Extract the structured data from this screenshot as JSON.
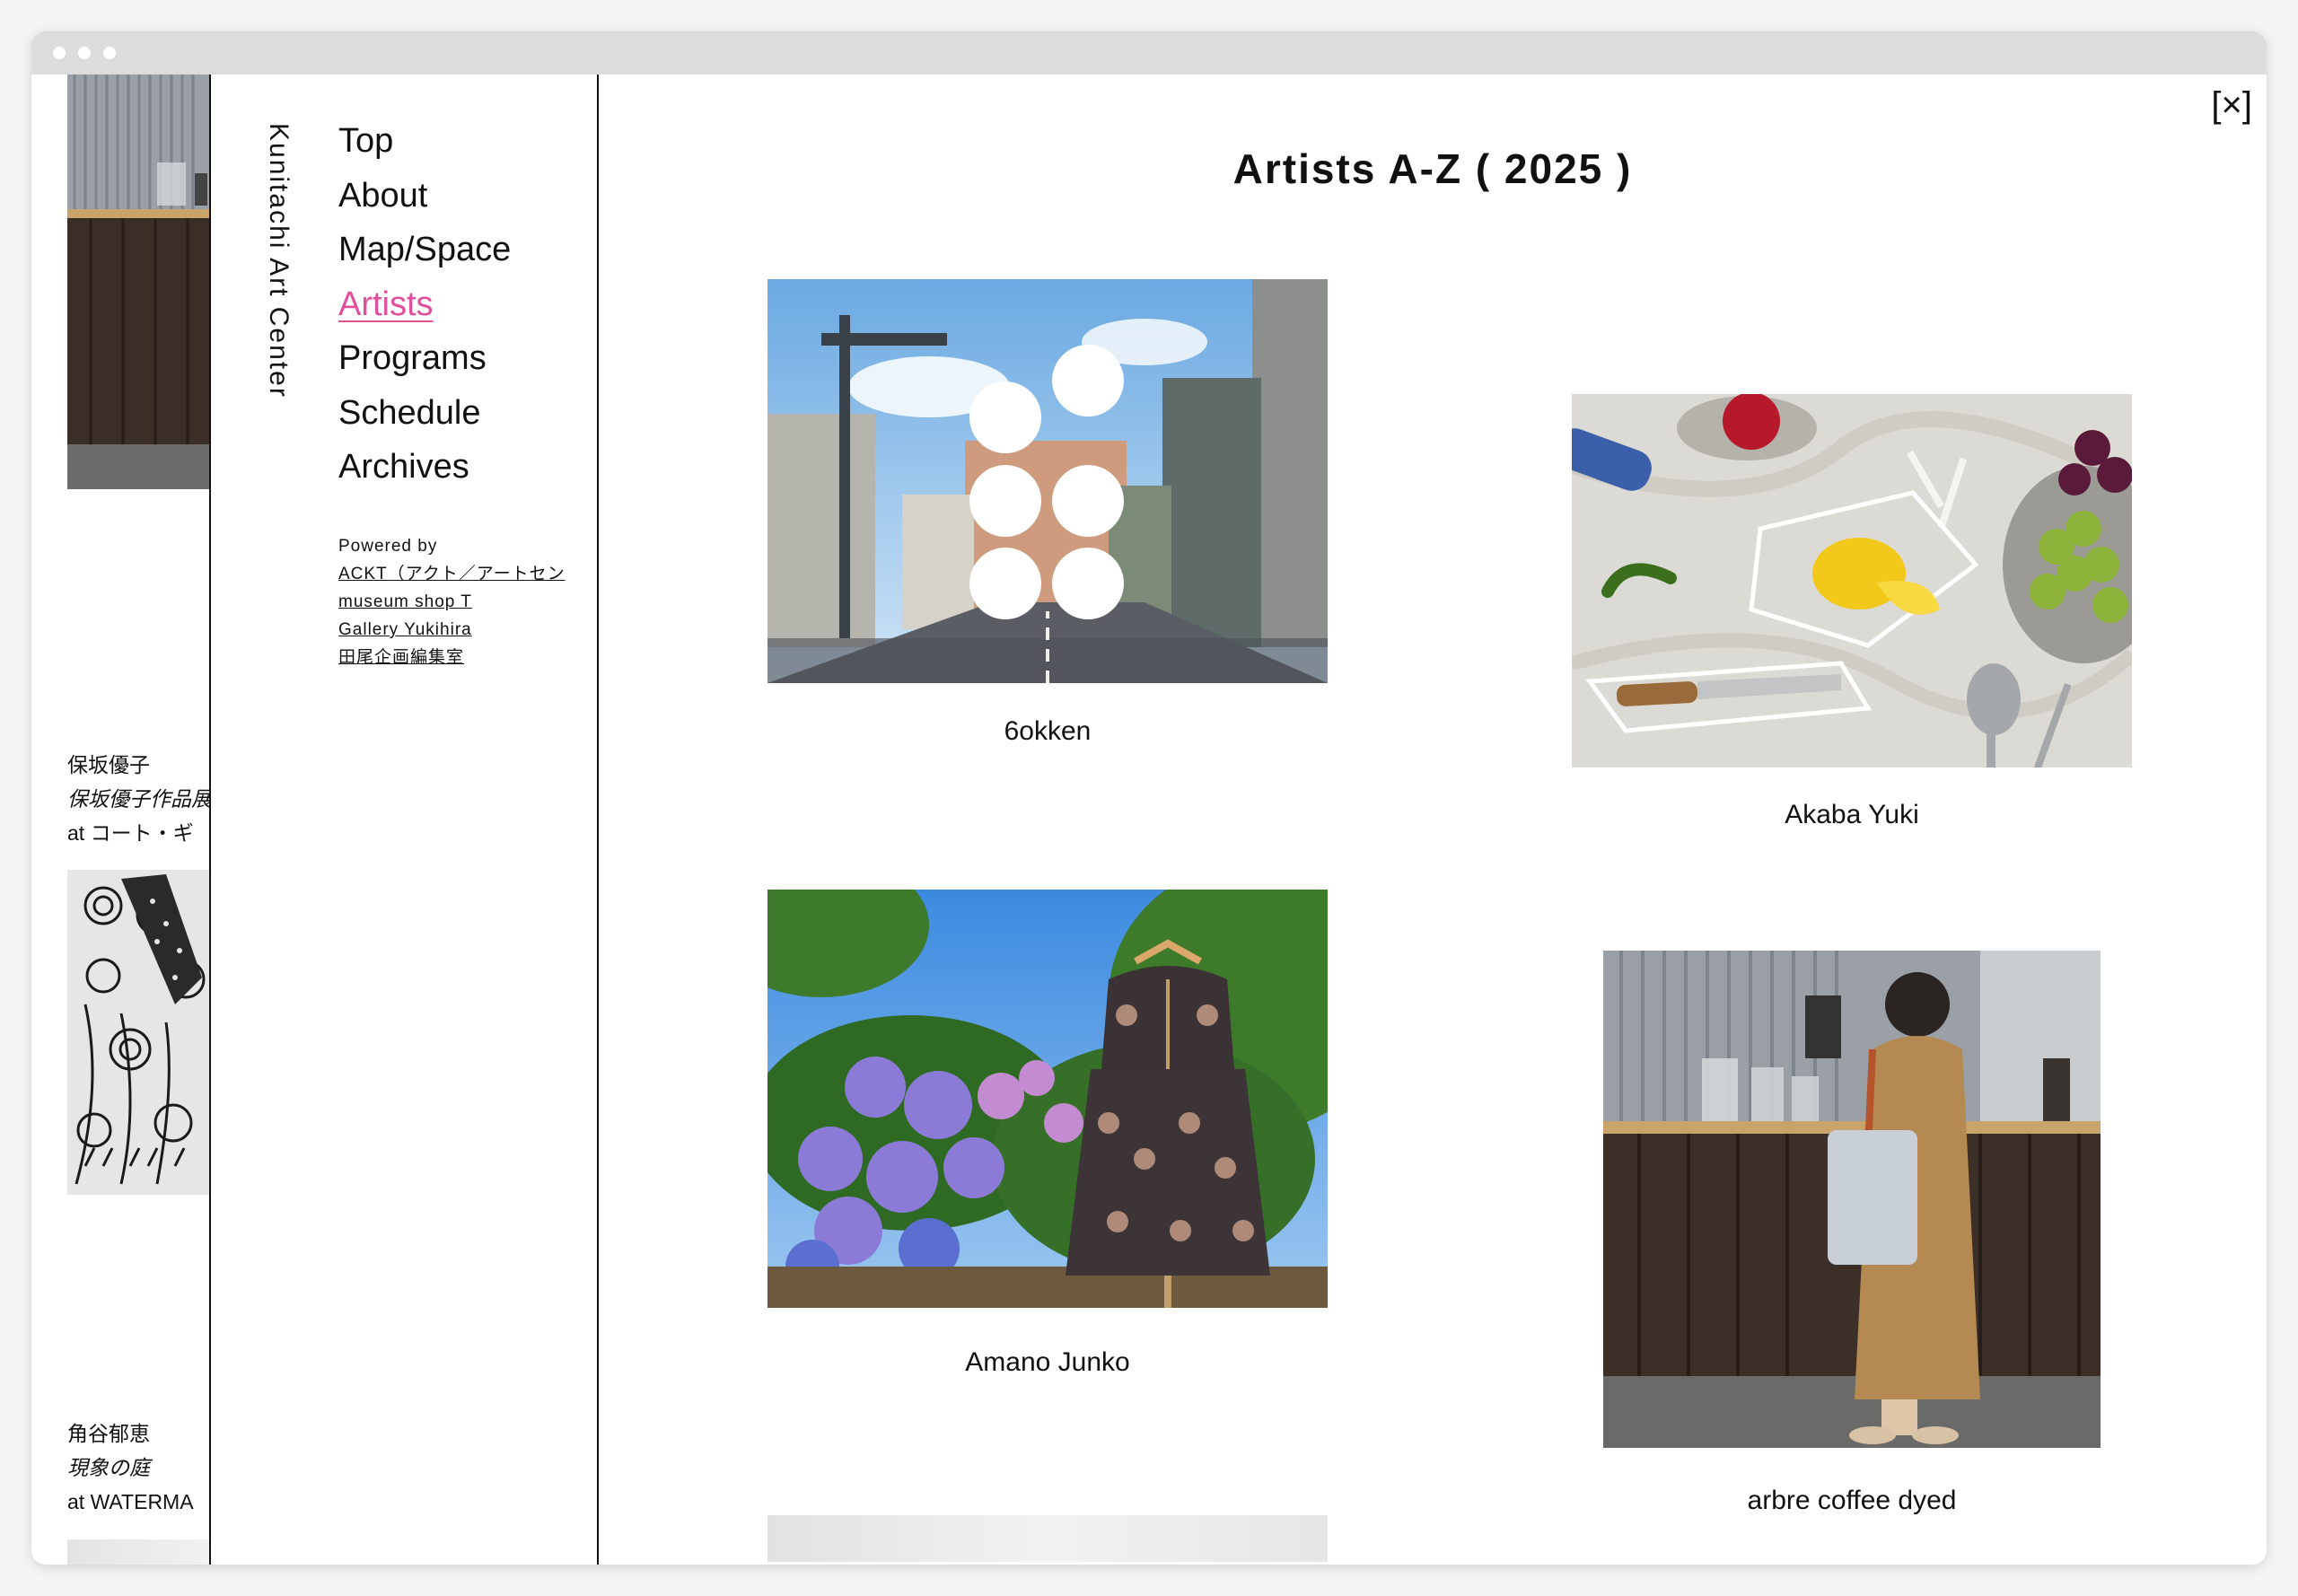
{
  "site": {
    "title": "Kunitachi Art Center"
  },
  "nav": {
    "items": [
      {
        "label": "Top",
        "active": false
      },
      {
        "label": "About",
        "active": false
      },
      {
        "label": "Map/Space",
        "active": false
      },
      {
        "label": "Artists",
        "active": true
      },
      {
        "label": "Programs",
        "active": false
      },
      {
        "label": "Schedule",
        "active": false
      },
      {
        "label": "Archives",
        "active": false
      }
    ],
    "powered_by_label": "Powered by",
    "sponsors": [
      "ACKT（アクト／アートセン",
      "museum shop T",
      "Gallery Yukihira",
      "田尾企画編集室"
    ]
  },
  "overlay": {
    "close_label": "[×]",
    "heading": "Artists A-Z ( 2025 )"
  },
  "artists": [
    {
      "name": "6okken"
    },
    {
      "name": "Akaba Yuki"
    },
    {
      "name": "Amano Junko"
    },
    {
      "name": "arbre coffee dyed"
    }
  ],
  "background_events": [
    {
      "artist": "保坂優子",
      "title": "保坂優子作品展",
      "venue": "at コート・ギ"
    },
    {
      "artist": "角谷郁恵",
      "title": "現象の庭",
      "venue": "at WATERMA"
    }
  ],
  "colors": {
    "accent": "#e0509c",
    "text": "#111111"
  }
}
